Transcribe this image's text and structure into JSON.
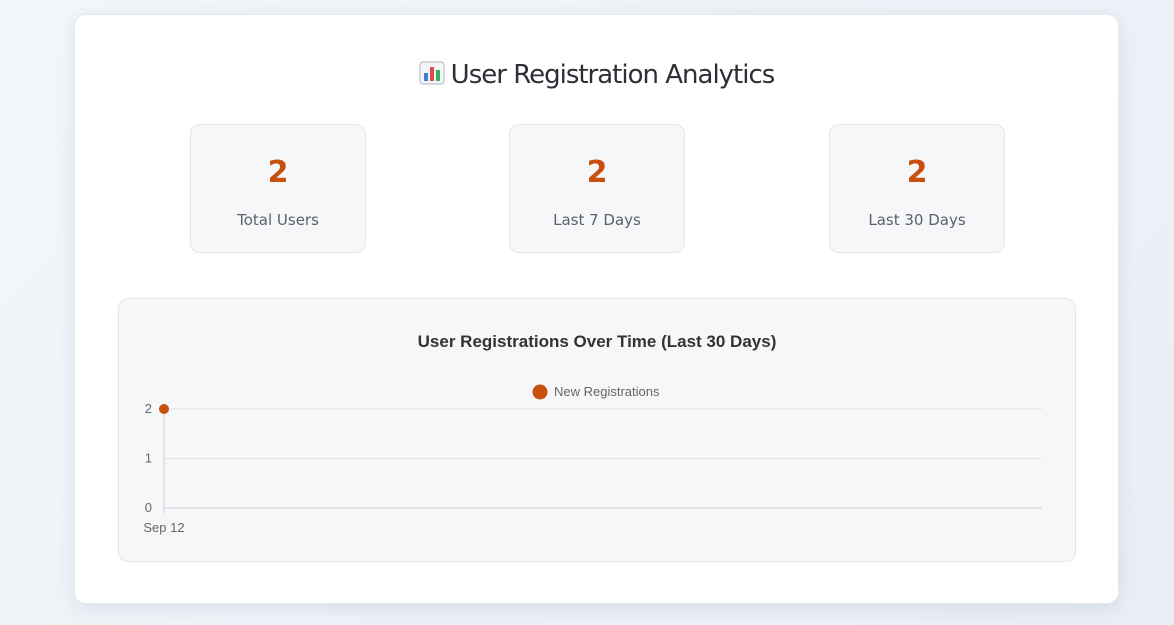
{
  "header": {
    "icon": "bar-chart-emoji-icon",
    "title": "User Registration Analytics"
  },
  "stats": [
    {
      "value": "2",
      "label": "Total Users"
    },
    {
      "value": "2",
      "label": "Last 7 Days"
    },
    {
      "value": "2",
      "label": "Last 30 Days"
    }
  ],
  "colors": {
    "accent": "#c8500f",
    "background": "#eef2f8",
    "card": "#ffffff",
    "panel": "#f6f7f9"
  },
  "chart_data": {
    "type": "line",
    "title": "User Registrations Over Time (Last 30 Days)",
    "x": [
      "Sep 12"
    ],
    "series": [
      {
        "name": "New Registrations",
        "values": [
          2
        ],
        "color": "#c8500f"
      }
    ],
    "ylim": [
      0,
      2
    ],
    "yticks": [
      0,
      1,
      2
    ],
    "xlabel": "",
    "ylabel": "",
    "grid": true,
    "legend": "top-center"
  }
}
